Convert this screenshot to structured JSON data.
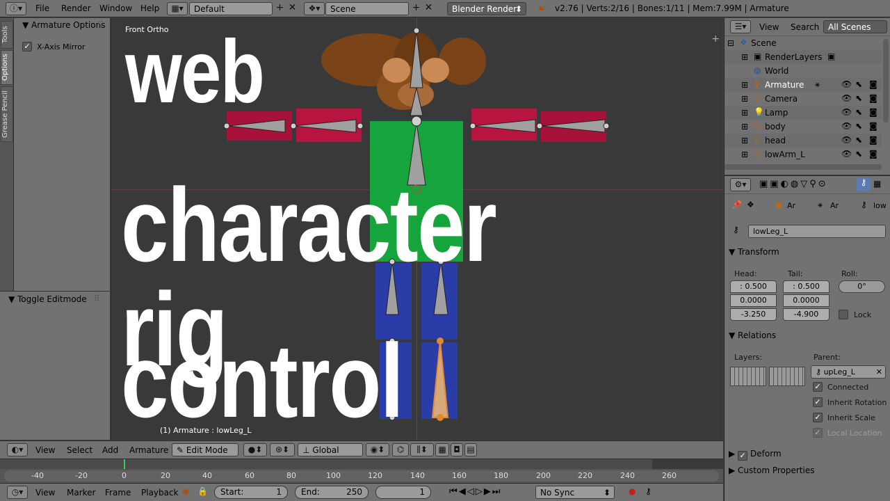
{
  "topbar": {
    "menus": [
      "File",
      "Render",
      "Window",
      "Help"
    ],
    "screen_layout": "Default",
    "scene": "Scene",
    "engine": "Blender Render",
    "stats": "v2.76 | Verts:2/16 | Bones:1/11 | Mem:7.99M | Armature"
  },
  "tools_panel": {
    "tabs": [
      "Tools",
      "Options",
      "Grease Pencil"
    ],
    "section_title": "Armature Options",
    "x_axis_mirror": "X-Axis Mirror",
    "toggle_title": "Toggle Editmode"
  },
  "viewport": {
    "view_name": "Front Ortho",
    "overlay_lines": [
      "web",
      "character rig",
      "control"
    ],
    "selection_info": "(1) Armature : lowLeg_L"
  },
  "viewport_header": {
    "menus": [
      "View",
      "Select",
      "Add",
      "Armature"
    ],
    "mode": "Edit Mode",
    "orientation": "Global"
  },
  "timeline": {
    "ticks": [
      "-40",
      "-20",
      "0",
      "20",
      "40",
      "60",
      "80",
      "100",
      "120",
      "140",
      "160",
      "180",
      "200",
      "220",
      "240",
      "260"
    ],
    "menus": [
      "View",
      "Marker",
      "Frame",
      "Playback"
    ],
    "start_label": "Start:",
    "start_value": "1",
    "end_label": "End:",
    "end_value": "250",
    "current_frame": "1",
    "sync": "No Sync"
  },
  "outliner": {
    "menus": [
      "View",
      "Search",
      "All Scenes"
    ],
    "rows": [
      {
        "label": "Scene"
      },
      {
        "label": "RenderLayers"
      },
      {
        "label": "World"
      },
      {
        "label": "Armature"
      },
      {
        "label": "Camera"
      },
      {
        "label": "Lamp"
      },
      {
        "label": "body"
      },
      {
        "label": "head"
      },
      {
        "label": "lowArm_L"
      }
    ]
  },
  "properties": {
    "breadcrumb": [
      "Ar",
      "Ar",
      "low"
    ],
    "bone_name": "lowLeg_L",
    "transform": {
      "title": "Transform",
      "head_label": "Head:",
      "tail_label": "Tail:",
      "roll_label": "Roll:",
      "head": [
        ": 0.500",
        "0.0000",
        "-3.250"
      ],
      "tail": [
        ": 0.500",
        "0.0000",
        "-4.900"
      ],
      "roll": "0°",
      "lock": "Lock"
    },
    "relations": {
      "title": "Relations",
      "layers_label": "Layers:",
      "parent_label": "Parent:",
      "parent": "upLeg_L",
      "connected": "Connected",
      "inherit_rotation": "Inherit Rotation",
      "inherit_scale": "Inherit Scale",
      "local_location": "Local Location"
    },
    "deform": "Deform",
    "custom_properties": "Custom Properties"
  }
}
